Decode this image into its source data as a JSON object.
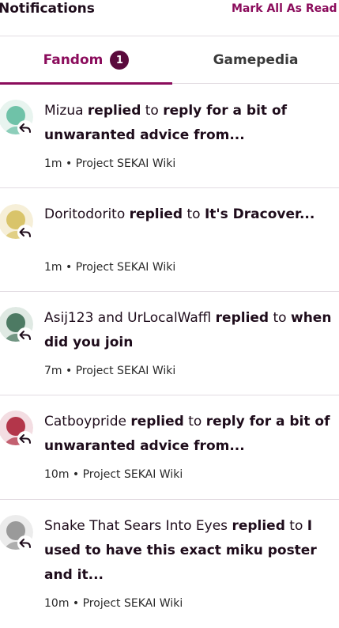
{
  "header": {
    "title": "Notifications",
    "mark_all": "Mark All As Read"
  },
  "tabs": [
    {
      "label": "Fandom",
      "badge": "1",
      "active": true
    },
    {
      "label": "Gamepedia",
      "active": false
    }
  ],
  "notifications": [
    {
      "actor": "Mizua",
      "verb": "replied",
      "connector": "to",
      "target": "reply for a bit of unwaranted advice from...",
      "meta": "1m • Project SEKAI Wiki",
      "avatar_color": "#6fc2a8"
    },
    {
      "actor": "Doritodorito",
      "verb": "replied",
      "connector": "to",
      "target": "It's Dracover...",
      "meta": "1m • Project SEKAI Wiki",
      "avatar_color": "#d9c46a"
    },
    {
      "actor": "Asij123 and UrLocalWaffl",
      "verb": "replied",
      "connector": "to",
      "target": "when did you join",
      "meta": "7m • Project SEKAI Wiki",
      "avatar_color": "#4d7a63"
    },
    {
      "actor": "Catboypride",
      "verb": "replied",
      "connector": "to",
      "target": "reply for a bit of unwaranted advice from...",
      "meta": "10m • Project SEKAI Wiki",
      "avatar_color": "#b3364a"
    },
    {
      "actor": "Snake That Sears Into Eyes",
      "verb": "replied",
      "connector": "to",
      "target": "I used to have this exact miku poster and it...",
      "meta": "10m • Project SEKAI Wiki",
      "avatar_color": "#9a9a9a"
    }
  ],
  "colors": {
    "accent": "#8b0c5c",
    "badge_bg": "#5a0a3c",
    "divider": "#e3dce2",
    "text": "#1e0c1b"
  },
  "icons": {
    "reply": "reply-arrow-icon"
  }
}
